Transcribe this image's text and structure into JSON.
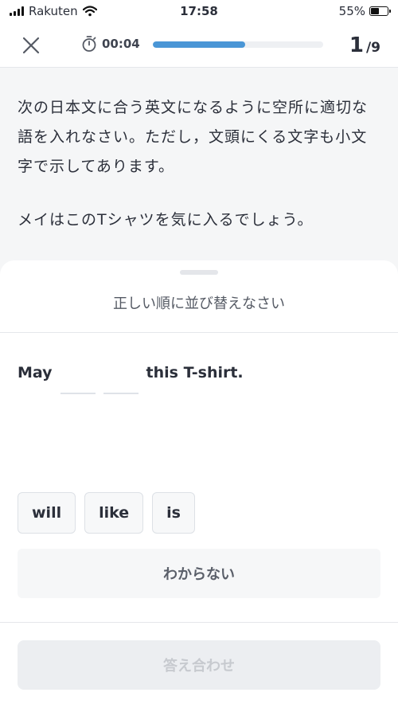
{
  "status_bar": {
    "carrier": "Rakuten",
    "time": "17:58",
    "battery_percent": "55%",
    "battery_level": 0.55
  },
  "header": {
    "close_icon": "close-icon",
    "timer_icon": "stopwatch-icon",
    "timer": "00:04",
    "progress": 0.54,
    "progress_color": "#4a96d6",
    "question_current": "1",
    "question_total": "/9"
  },
  "question": {
    "instruction": "次の日本文に合う英文になるように空所に適切な語を入れなさい。ただし，文頭にくる文字も小文字で示してあります。",
    "japanese_sentence": "メイはこのTシャツを気に入るでしょう。"
  },
  "sheet": {
    "title": "正しい順に並び替えなさい",
    "answer_start": "May",
    "answer_end": "this T-shirt.",
    "blank_count": 2,
    "choices": [
      "will",
      "like",
      "is"
    ],
    "unknown_label": "わからない",
    "submit_label": "答え合わせ"
  }
}
